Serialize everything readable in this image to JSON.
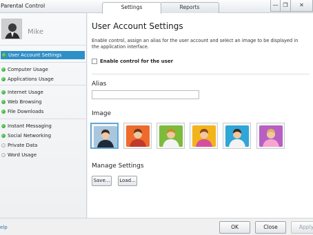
{
  "window": {
    "title": "Parental Control",
    "tabs": [
      {
        "label": "Settings",
        "active": true
      },
      {
        "label": "Reports",
        "active": false
      }
    ],
    "controls": [
      "minimize",
      "restore",
      "close"
    ],
    "close_glyph": "✕",
    "min_glyph": "—",
    "restore_glyph": "❐"
  },
  "sidebar": {
    "username": "Mike",
    "groups": [
      [
        {
          "label": "User Account Settings",
          "active": true,
          "enabled": true
        }
      ],
      [
        {
          "label": "Computer Usage",
          "active": false,
          "enabled": true
        },
        {
          "label": "Applications Usage",
          "active": false,
          "enabled": true
        }
      ],
      [
        {
          "label": "Internet Usage",
          "active": false,
          "enabled": true
        },
        {
          "label": "Web Browsing",
          "active": false,
          "enabled": true
        },
        {
          "label": "File Downloads",
          "active": false,
          "enabled": true
        }
      ],
      [
        {
          "label": "Instant Messaging",
          "active": false,
          "enabled": true
        },
        {
          "label": "Social Networking",
          "active": false,
          "enabled": true
        },
        {
          "label": "Private Data",
          "active": false,
          "enabled": false
        },
        {
          "label": "Word Usage",
          "active": false,
          "enabled": false
        }
      ]
    ]
  },
  "main": {
    "title": "User Account Settings",
    "description": "Enable control, assign an alias for the user account and select an image to be displayed in the application interface.",
    "enable_checkbox": {
      "label": "Enable control for the user",
      "checked": false
    },
    "alias": {
      "heading": "Alias",
      "value": ""
    },
    "image": {
      "heading": "Image",
      "options": [
        {
          "name": "man-in-suit-avatar",
          "bg": "#a8c7df",
          "selected": true
        },
        {
          "name": "woman-orange-avatar",
          "bg": "#ef6b2c",
          "selected": false
        },
        {
          "name": "boy-green-avatar",
          "bg": "#7dbb3a",
          "selected": false
        },
        {
          "name": "girl-yellow-avatar",
          "bg": "#f3b31c",
          "selected": false
        },
        {
          "name": "man-blue-avatar",
          "bg": "#2ea6d8",
          "selected": false
        },
        {
          "name": "girl-purple-avatar",
          "bg": "#b85fc4",
          "selected": false
        }
      ]
    },
    "manage": {
      "heading": "Manage Settings",
      "save_label": "Save...",
      "load_label": "Load..."
    }
  },
  "footer": {
    "help_label": "elp",
    "ok_label": "OK",
    "close_label": "Close",
    "apply_label": "Apply"
  },
  "colors": {
    "accent": "#2f8fc7",
    "status_on": "#2aa02a"
  }
}
